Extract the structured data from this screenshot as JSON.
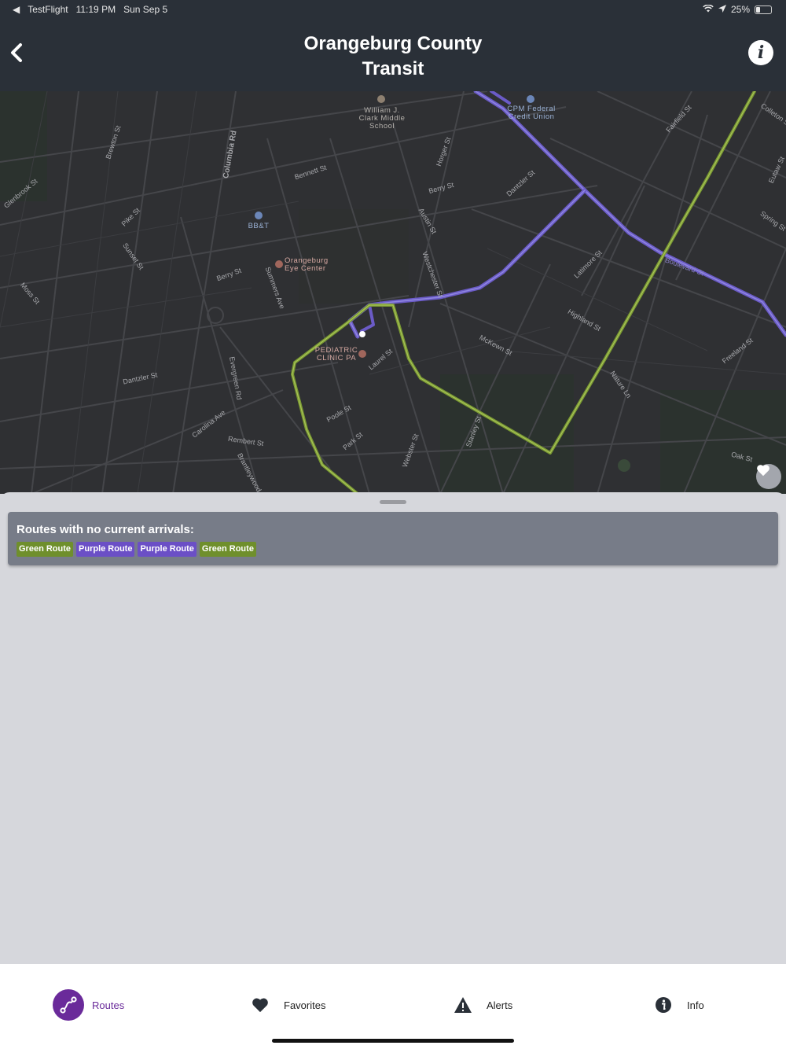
{
  "status": {
    "carrier": "TestFlight",
    "time": "11:19 PM",
    "date": "Sun Sep 5",
    "battery": "25%",
    "battery_level": 0.25
  },
  "header": {
    "title_line1": "Orangeburg County",
    "title_line2": "Transit"
  },
  "map": {
    "streets": [
      "Brewton St",
      "Columbia Rd",
      "Bennett St",
      "Horger St",
      "Berry St",
      "Dantzler St",
      "Fairfield St",
      "Colleton St",
      "Eutaw St",
      "Spring St",
      "Pike St",
      "Sunset St",
      "Berry St",
      "Summers Ave",
      "Austin St",
      "Westchester St",
      "Latimore St",
      "Boulevard St",
      "Highland St",
      "McKewn St",
      "Freeland St",
      "Nature Ln",
      "Laurel St",
      "Moss St",
      "Dantzler St",
      "Evergreen Rd",
      "Carolina Ave",
      "Poole St",
      "Park St",
      "Rembert St",
      "Brantleywood",
      "Webster St",
      "Stanley St",
      "Oak St",
      "Glenbrook St"
    ],
    "pois": {
      "school": "William J.\nClark Middle\nSchool",
      "credit_union": "CPM Federal\nCredit Union",
      "bank": "BB&T",
      "eye_center": "Orangeburg\nEye Center",
      "clinic": "PEDIATRIC\nCLINIC PA"
    },
    "route_colors": {
      "green": "#7a9a32",
      "purple": "#6b5bc7"
    }
  },
  "sheet": {
    "heading": "Routes with no current arrivals:",
    "routes": [
      {
        "label": "Green Route",
        "color": "#6f8f2c"
      },
      {
        "label": "Purple Route",
        "color": "#6b4fc6"
      },
      {
        "label": "Purple Route",
        "color": "#6b4fc6"
      },
      {
        "label": "Green Route",
        "color": "#6f8f2c"
      }
    ]
  },
  "tabs": {
    "routes": "Routes",
    "favorites": "Favorites",
    "alerts": "Alerts",
    "info": "Info"
  }
}
